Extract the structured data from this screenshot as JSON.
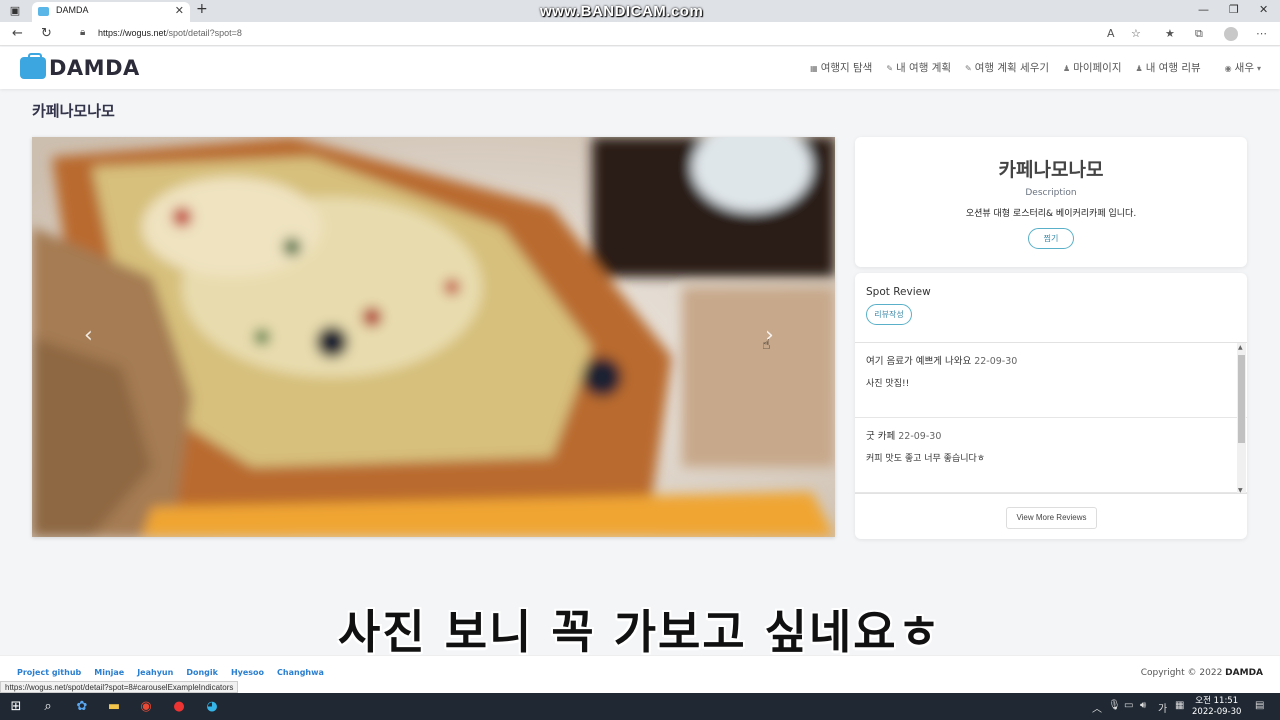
{
  "browser": {
    "tab_title": "DAMDA",
    "new_tab": "+",
    "url_host": "https://wogus.net",
    "url_path": "/spot/detail?spot=8",
    "watermark": "www.BANDICAM.com",
    "status_url": "https://wogus.net/spot/detail?spot=8#carouselExampleIndicators"
  },
  "site": {
    "logo": "DAMDA",
    "nav": [
      {
        "icon": "grid-icon",
        "label": "여행지 탐색"
      },
      {
        "icon": "pencil-icon",
        "label": "내 여행 계획"
      },
      {
        "icon": "pencil-icon",
        "label": "여행 계획 세우기"
      },
      {
        "icon": "person-icon",
        "label": "마이페이지"
      },
      {
        "icon": "person-icon",
        "label": "내 여행 리뷰"
      },
      {
        "icon": "user-circle-icon",
        "label": "새우"
      }
    ]
  },
  "spot": {
    "page_title": "카페나모나모",
    "name": "카페나모나모",
    "description_label": "Description",
    "description": "오션뷰 대형 로스터리& 베이커리카페 입니다.",
    "like_button": "찜기"
  },
  "reviews": {
    "title": "Spot Review",
    "write_button": "리뷰작성",
    "items": [
      {
        "title": "여기 음료가 예쁘게 나와요",
        "date": "22-09-30",
        "body": "사진 맛집!!"
      },
      {
        "title": "굿 카페",
        "date": "22-09-30",
        "body": "커피 맛도 좋고 너무 좋습니다ㅎ"
      }
    ],
    "more_button": "View More Reviews"
  },
  "subtitle": "사진 보니 꼭 가보고 싶네요ㅎ",
  "footer": {
    "links": [
      "Project github",
      "Minjae",
      "Jeahyun",
      "Dongik",
      "Hyesoo",
      "Changhwa"
    ],
    "copyright_prefix": "Copyright © 2022",
    "copyright_brand": "DAMDA"
  },
  "taskbar": {
    "time": "오전 11:51",
    "date": "2022-09-30"
  },
  "colors": {
    "accent": "#3ca6e0",
    "link": "#2a7fd0",
    "button_border": "#5ab0c8"
  }
}
